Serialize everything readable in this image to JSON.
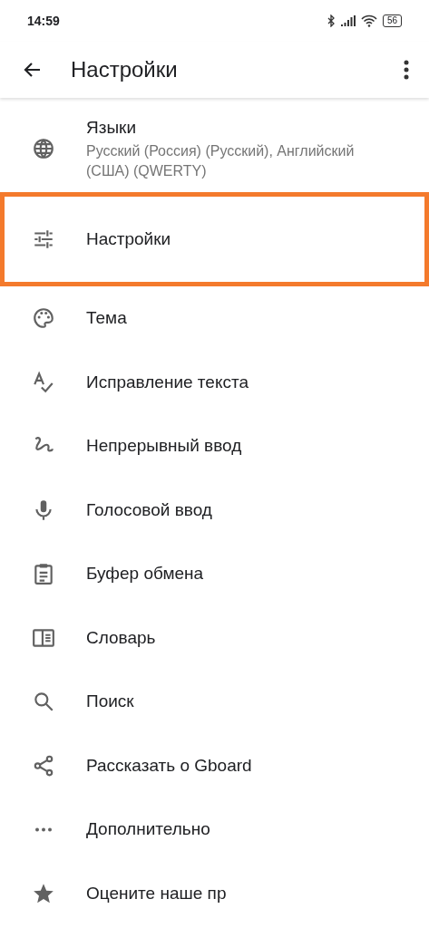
{
  "status_bar": {
    "time": "14:59",
    "battery": "56"
  },
  "app_bar": {
    "title": "Настройки"
  },
  "items": [
    {
      "title": "Языки",
      "subtitle": "Русский (Россия) (Русский), Английский (США) (QWERTY)",
      "highlighted": false
    },
    {
      "title": "Настройки",
      "highlighted": true
    },
    {
      "title": "Тема",
      "highlighted": false
    },
    {
      "title": "Исправление текста",
      "highlighted": false
    },
    {
      "title": "Непрерывный ввод",
      "highlighted": false
    },
    {
      "title": "Голосовой ввод",
      "highlighted": false
    },
    {
      "title": "Буфер обмена",
      "highlighted": false
    },
    {
      "title": "Словарь",
      "highlighted": false
    },
    {
      "title": "Поиск",
      "highlighted": false
    },
    {
      "title": "Рассказать о Gboard",
      "highlighted": false
    },
    {
      "title": "Дополнительно",
      "highlighted": false
    },
    {
      "title": "Оцените наше пр",
      "highlighted": false
    }
  ]
}
